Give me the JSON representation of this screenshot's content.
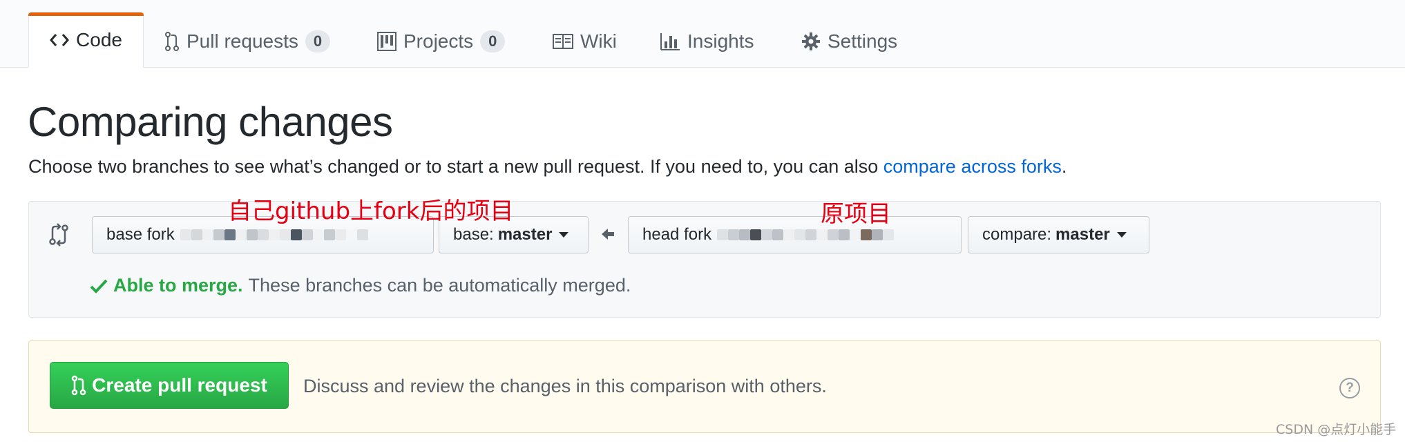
{
  "tabs": {
    "code": "Code",
    "pull_requests": "Pull requests",
    "pull_requests_count": "0",
    "projects": "Projects",
    "projects_count": "0",
    "wiki": "Wiki",
    "insights": "Insights",
    "settings": "Settings"
  },
  "page": {
    "title": "Comparing changes",
    "subtitle": "Choose two branches to see what’s changed or to start a new pull request. If you need to, you can also ",
    "subtitle_link": "compare across forks",
    "subtitle_end": "."
  },
  "compare": {
    "base_fork_label": "base fork",
    "base_branch_label": "base:",
    "base_branch_value": "master",
    "head_fork_label": "head fork",
    "compare_branch_label": "compare:",
    "compare_branch_value": "master",
    "merge_status": "Able to merge.",
    "merge_detail": "These branches can be automatically merged."
  },
  "annotations": {
    "base_note": "自己github上fork后的项目",
    "head_note": "原项目"
  },
  "create": {
    "button_label": "Create pull request",
    "description": "Discuss and review the changes in this comparison with others.",
    "help_glyph": "?"
  },
  "watermark": "CSDN @点灯小能手",
  "colors": {
    "accent_tab": "#e36209",
    "link": "#0366d6",
    "success": "#28a745",
    "annotation": "#e60012"
  }
}
